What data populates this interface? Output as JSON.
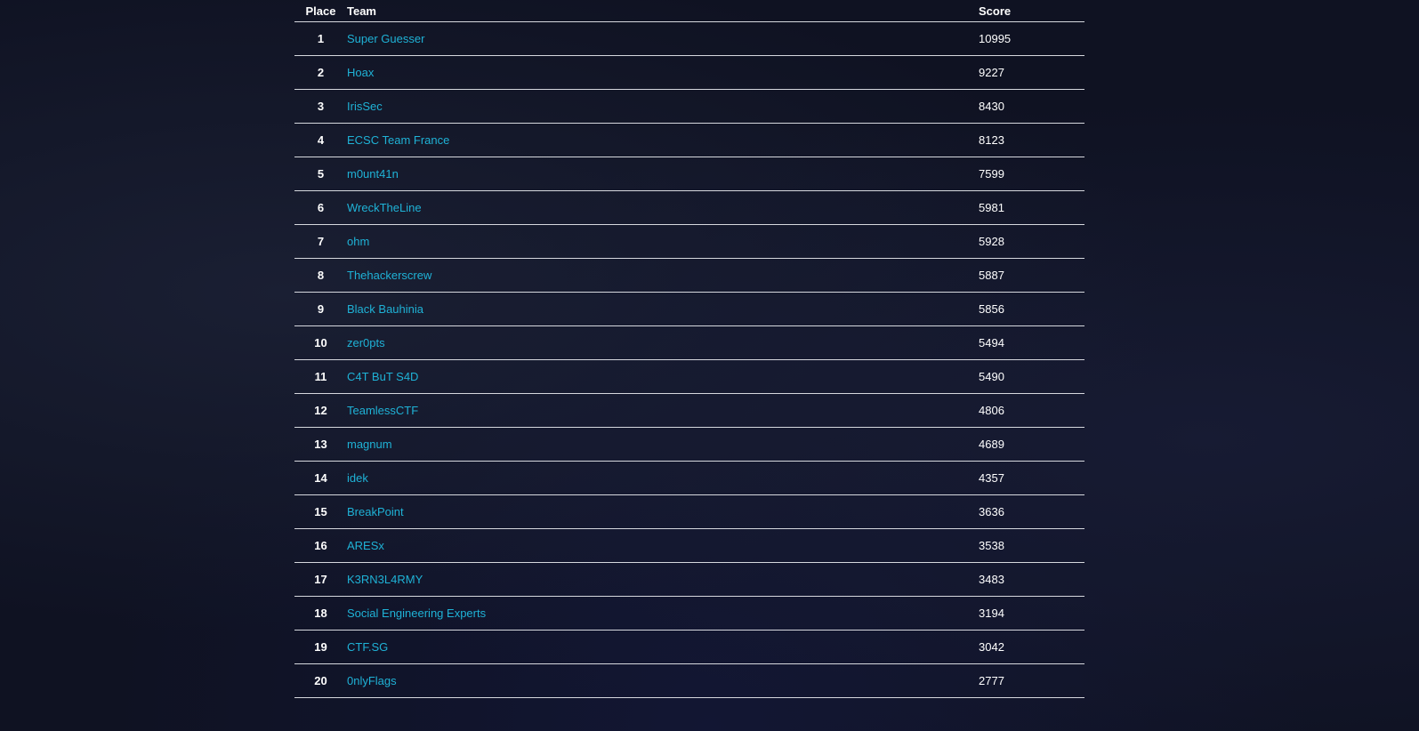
{
  "scoreboard": {
    "headers": {
      "place": "Place",
      "team": "Team",
      "score": "Score"
    },
    "rows": [
      {
        "place": "1",
        "team": "Super Guesser",
        "score": "10995"
      },
      {
        "place": "2",
        "team": "Hoax",
        "score": "9227"
      },
      {
        "place": "3",
        "team": "IrisSec",
        "score": "8430"
      },
      {
        "place": "4",
        "team": "ECSC Team France",
        "score": "8123"
      },
      {
        "place": "5",
        "team": "m0unt41n",
        "score": "7599"
      },
      {
        "place": "6",
        "team": "WreckTheLine",
        "score": "5981"
      },
      {
        "place": "7",
        "team": "ohm",
        "score": "5928"
      },
      {
        "place": "8",
        "team": "Thehackerscrew",
        "score": "5887"
      },
      {
        "place": "9",
        "team": "Black Bauhinia",
        "score": "5856"
      },
      {
        "place": "10",
        "team": "zer0pts",
        "score": "5494"
      },
      {
        "place": "11",
        "team": "C4T BuT S4D",
        "score": "5490"
      },
      {
        "place": "12",
        "team": "TeamlessCTF",
        "score": "4806"
      },
      {
        "place": "13",
        "team": "magnum",
        "score": "4689"
      },
      {
        "place": "14",
        "team": "idek",
        "score": "4357"
      },
      {
        "place": "15",
        "team": "BreakPoint",
        "score": "3636"
      },
      {
        "place": "16",
        "team": "ARESx",
        "score": "3538"
      },
      {
        "place": "17",
        "team": "K3RN3L4RMY",
        "score": "3483"
      },
      {
        "place": "18",
        "team": "Social Engineering Experts",
        "score": "3194"
      },
      {
        "place": "19",
        "team": "CTF.SG",
        "score": "3042"
      },
      {
        "place": "20",
        "team": "0nlyFlags",
        "score": "2777"
      }
    ]
  },
  "colors": {
    "background": "#0f1222",
    "team_link": "#1fb2d6",
    "text": "#ffffff",
    "divider": "#d6d8de"
  }
}
